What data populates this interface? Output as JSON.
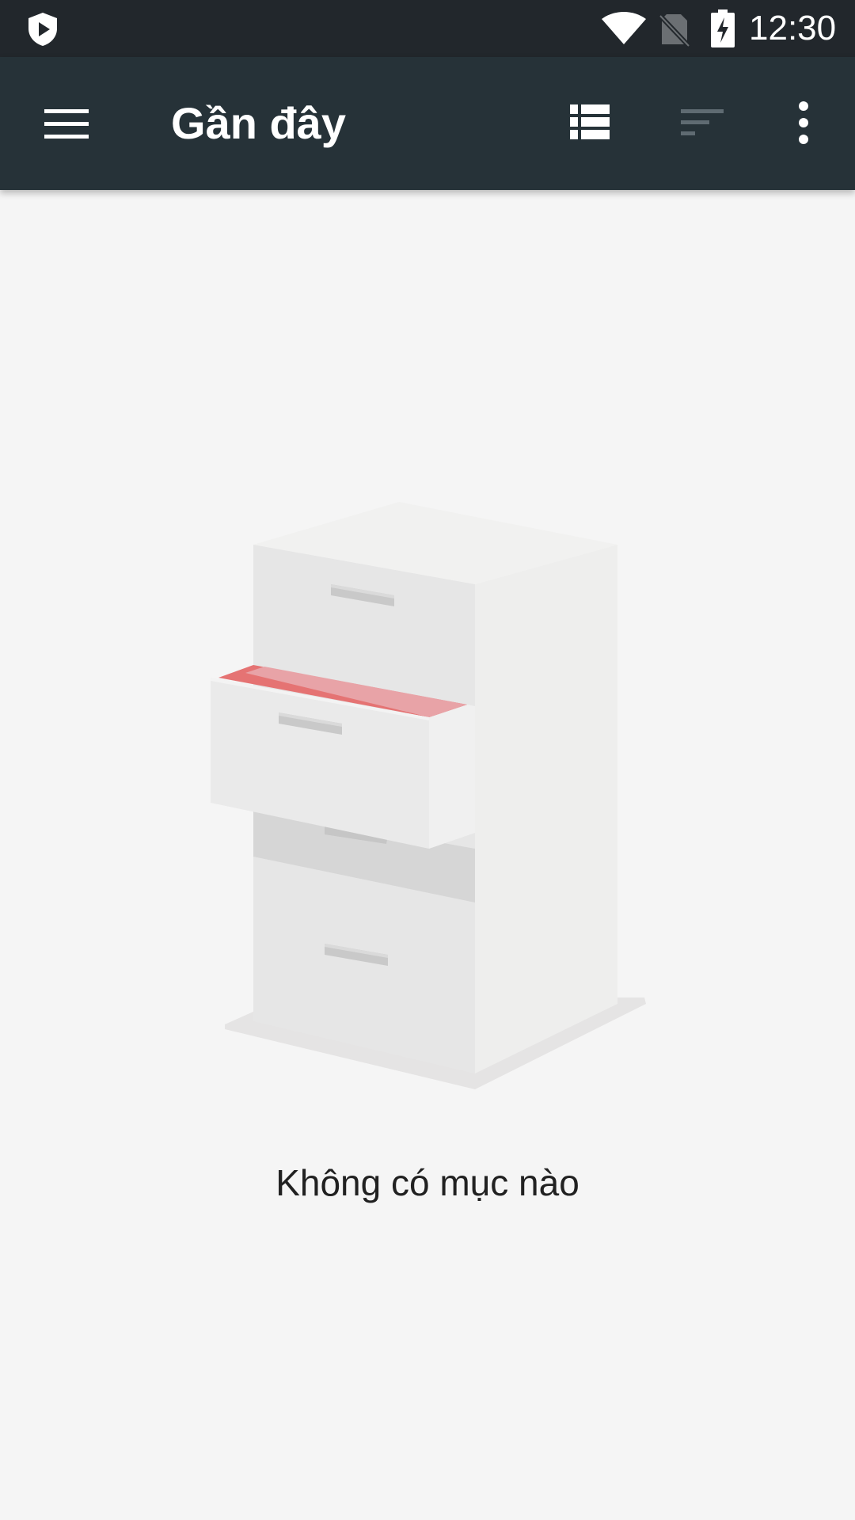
{
  "status_bar": {
    "time": "12:30",
    "icons": [
      "shield-play-icon",
      "wifi-icon",
      "no-sim-icon",
      "battery-charging-icon"
    ]
  },
  "app_bar": {
    "title": "Gần đây",
    "icons": [
      "hamburger-menu-icon",
      "list-view-icon",
      "sort-icon",
      "more-vert-icon"
    ]
  },
  "main": {
    "empty_message": "Không có mục nào",
    "illustration": "file-cabinet-illustration"
  },
  "colors": {
    "status_bar_bg": "#22272c",
    "app_bar_bg": "#263238",
    "page_bg": "#f5f5f5",
    "drawer_accent": "#e57373"
  }
}
